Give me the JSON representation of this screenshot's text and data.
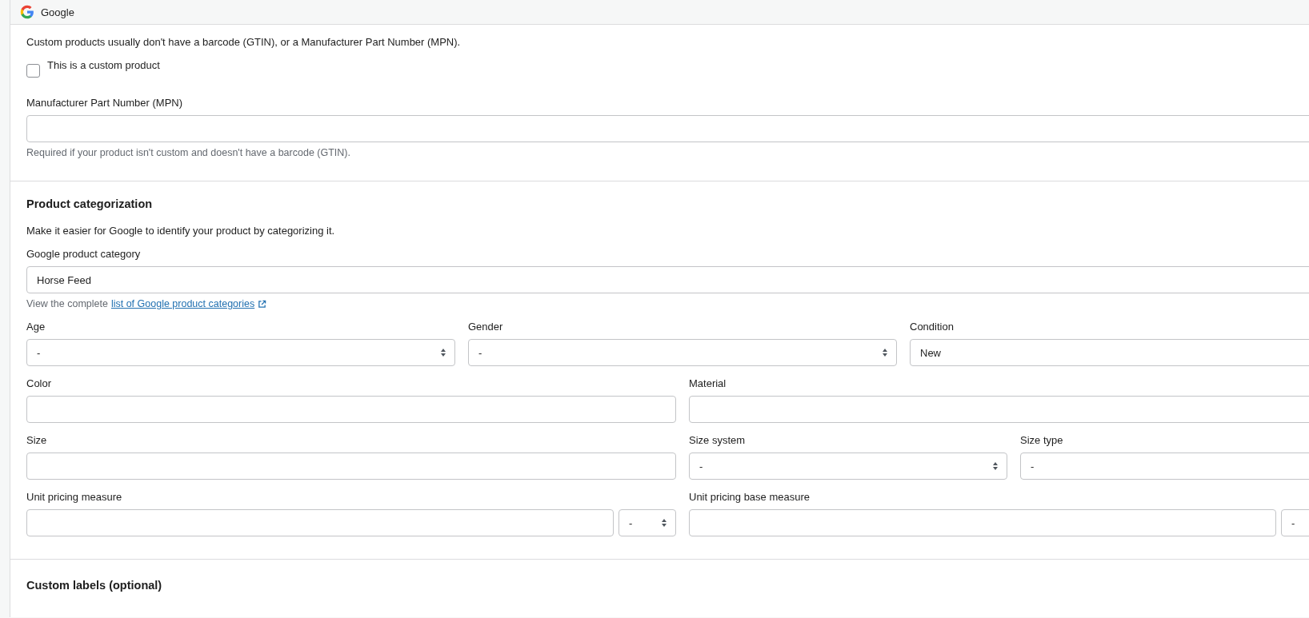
{
  "panel": {
    "title": "Google"
  },
  "identifiers": {
    "note": "Custom products usually don't have a barcode (GTIN), or a Manufacturer Part Number (MPN).",
    "custom_product": {
      "label": "This is a custom product",
      "checked": false
    },
    "mpn": {
      "label": "Manufacturer Part Number (MPN)",
      "help": "Required if your product isn't custom and doesn't have a barcode (GTIN)."
    }
  },
  "categorization": {
    "heading": "Product categorization",
    "description": "Make it easier for Google to identify your product by categorizing it.",
    "category": {
      "label": "Google product category",
      "value": "Horse Feed"
    },
    "help_text": "View the complete",
    "help_link": "list of Google product categories",
    "rows": [
      [
        {
          "label": "Age",
          "kind": "select",
          "value": "-"
        },
        {
          "label": "Gender",
          "kind": "select",
          "value": "-"
        },
        {
          "label": "Condition",
          "kind": "select",
          "value": "New"
        }
      ],
      [
        {
          "label": "Color",
          "kind": "text"
        },
        {
          "label": "Material",
          "kind": "text"
        }
      ],
      [
        {
          "label": "Size",
          "kind": "text"
        },
        {
          "label": "Size system",
          "kind": "select",
          "value": "-"
        },
        {
          "label": "Size type",
          "kind": "select",
          "value": "-"
        }
      ],
      [
        {
          "label": "Unit pricing measure",
          "kind": "text-with-unit",
          "unit": "-"
        },
        {
          "label": "Unit pricing base measure",
          "kind": "text-with-unit",
          "unit": "-"
        }
      ]
    ]
  },
  "next_section": {
    "heading": "Custom labels (optional)"
  }
}
